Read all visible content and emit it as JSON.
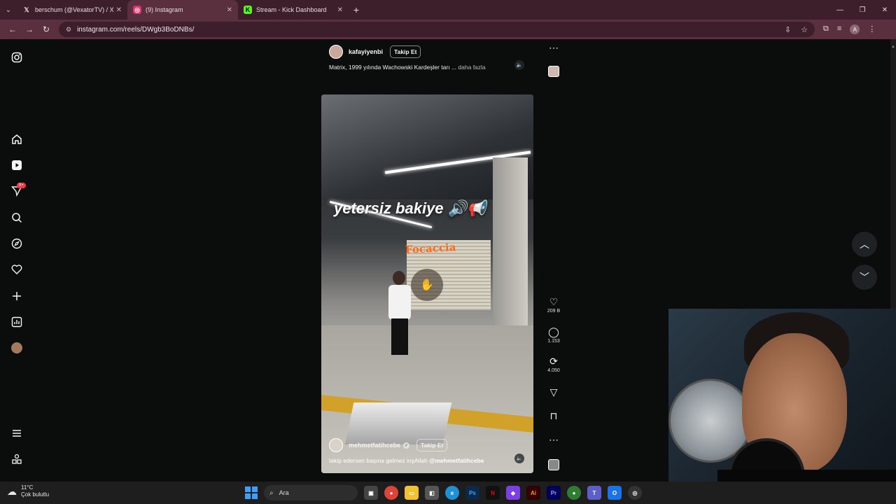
{
  "browser": {
    "tabs": [
      {
        "label": "berschum (@VexatorTV) / X",
        "icon": "x-logo-icon",
        "active": false
      },
      {
        "label": "(9) Instagram",
        "icon": "instagram-icon",
        "active": true
      },
      {
        "label": "Stream - Kick Dashboard",
        "icon": "kick-icon",
        "active": false
      }
    ],
    "url": "instagram.com/reels/DWgb3BoDNBs/",
    "profile_initial": "A"
  },
  "sidebar": {
    "notification_badge": "9+",
    "items": [
      "instagram-logo-icon",
      "home-icon",
      "reels-icon",
      "messages-icon",
      "search-icon",
      "explore-icon",
      "heart-icon",
      "create-icon",
      "dashboard-icon",
      "profile-avatar",
      "menu-icon",
      "more-apps-icon"
    ]
  },
  "prev_reel": {
    "author": "kafayiyenbi",
    "follow_label": "Takip Et",
    "caption": "Matrix, 1999 yılında Wachowski Kardeşler tarı ...",
    "more_label": "daha fazla"
  },
  "reel": {
    "overlay_text": "yetersiz bakiye 🔊📢",
    "author": "mehmetfatihcebe",
    "follow_label": "Takip Et",
    "caption": "takip edersen başına gelmez inşAllah",
    "caption_mention": "@mehmetfatihcebe",
    "shop_sign": "Focaccia",
    "likes": "209 B",
    "comments": "1.153",
    "reposts": "4.050"
  },
  "taskbar": {
    "temperature": "11°C",
    "weather": "Çok bulutlu",
    "search_placeholder": "Ara"
  },
  "colors": {
    "tab_bar": "#3c1f2a",
    "active_tab": "#5a2f3e",
    "page_bg": "#0b0d0d",
    "badge": "#ff3040"
  }
}
